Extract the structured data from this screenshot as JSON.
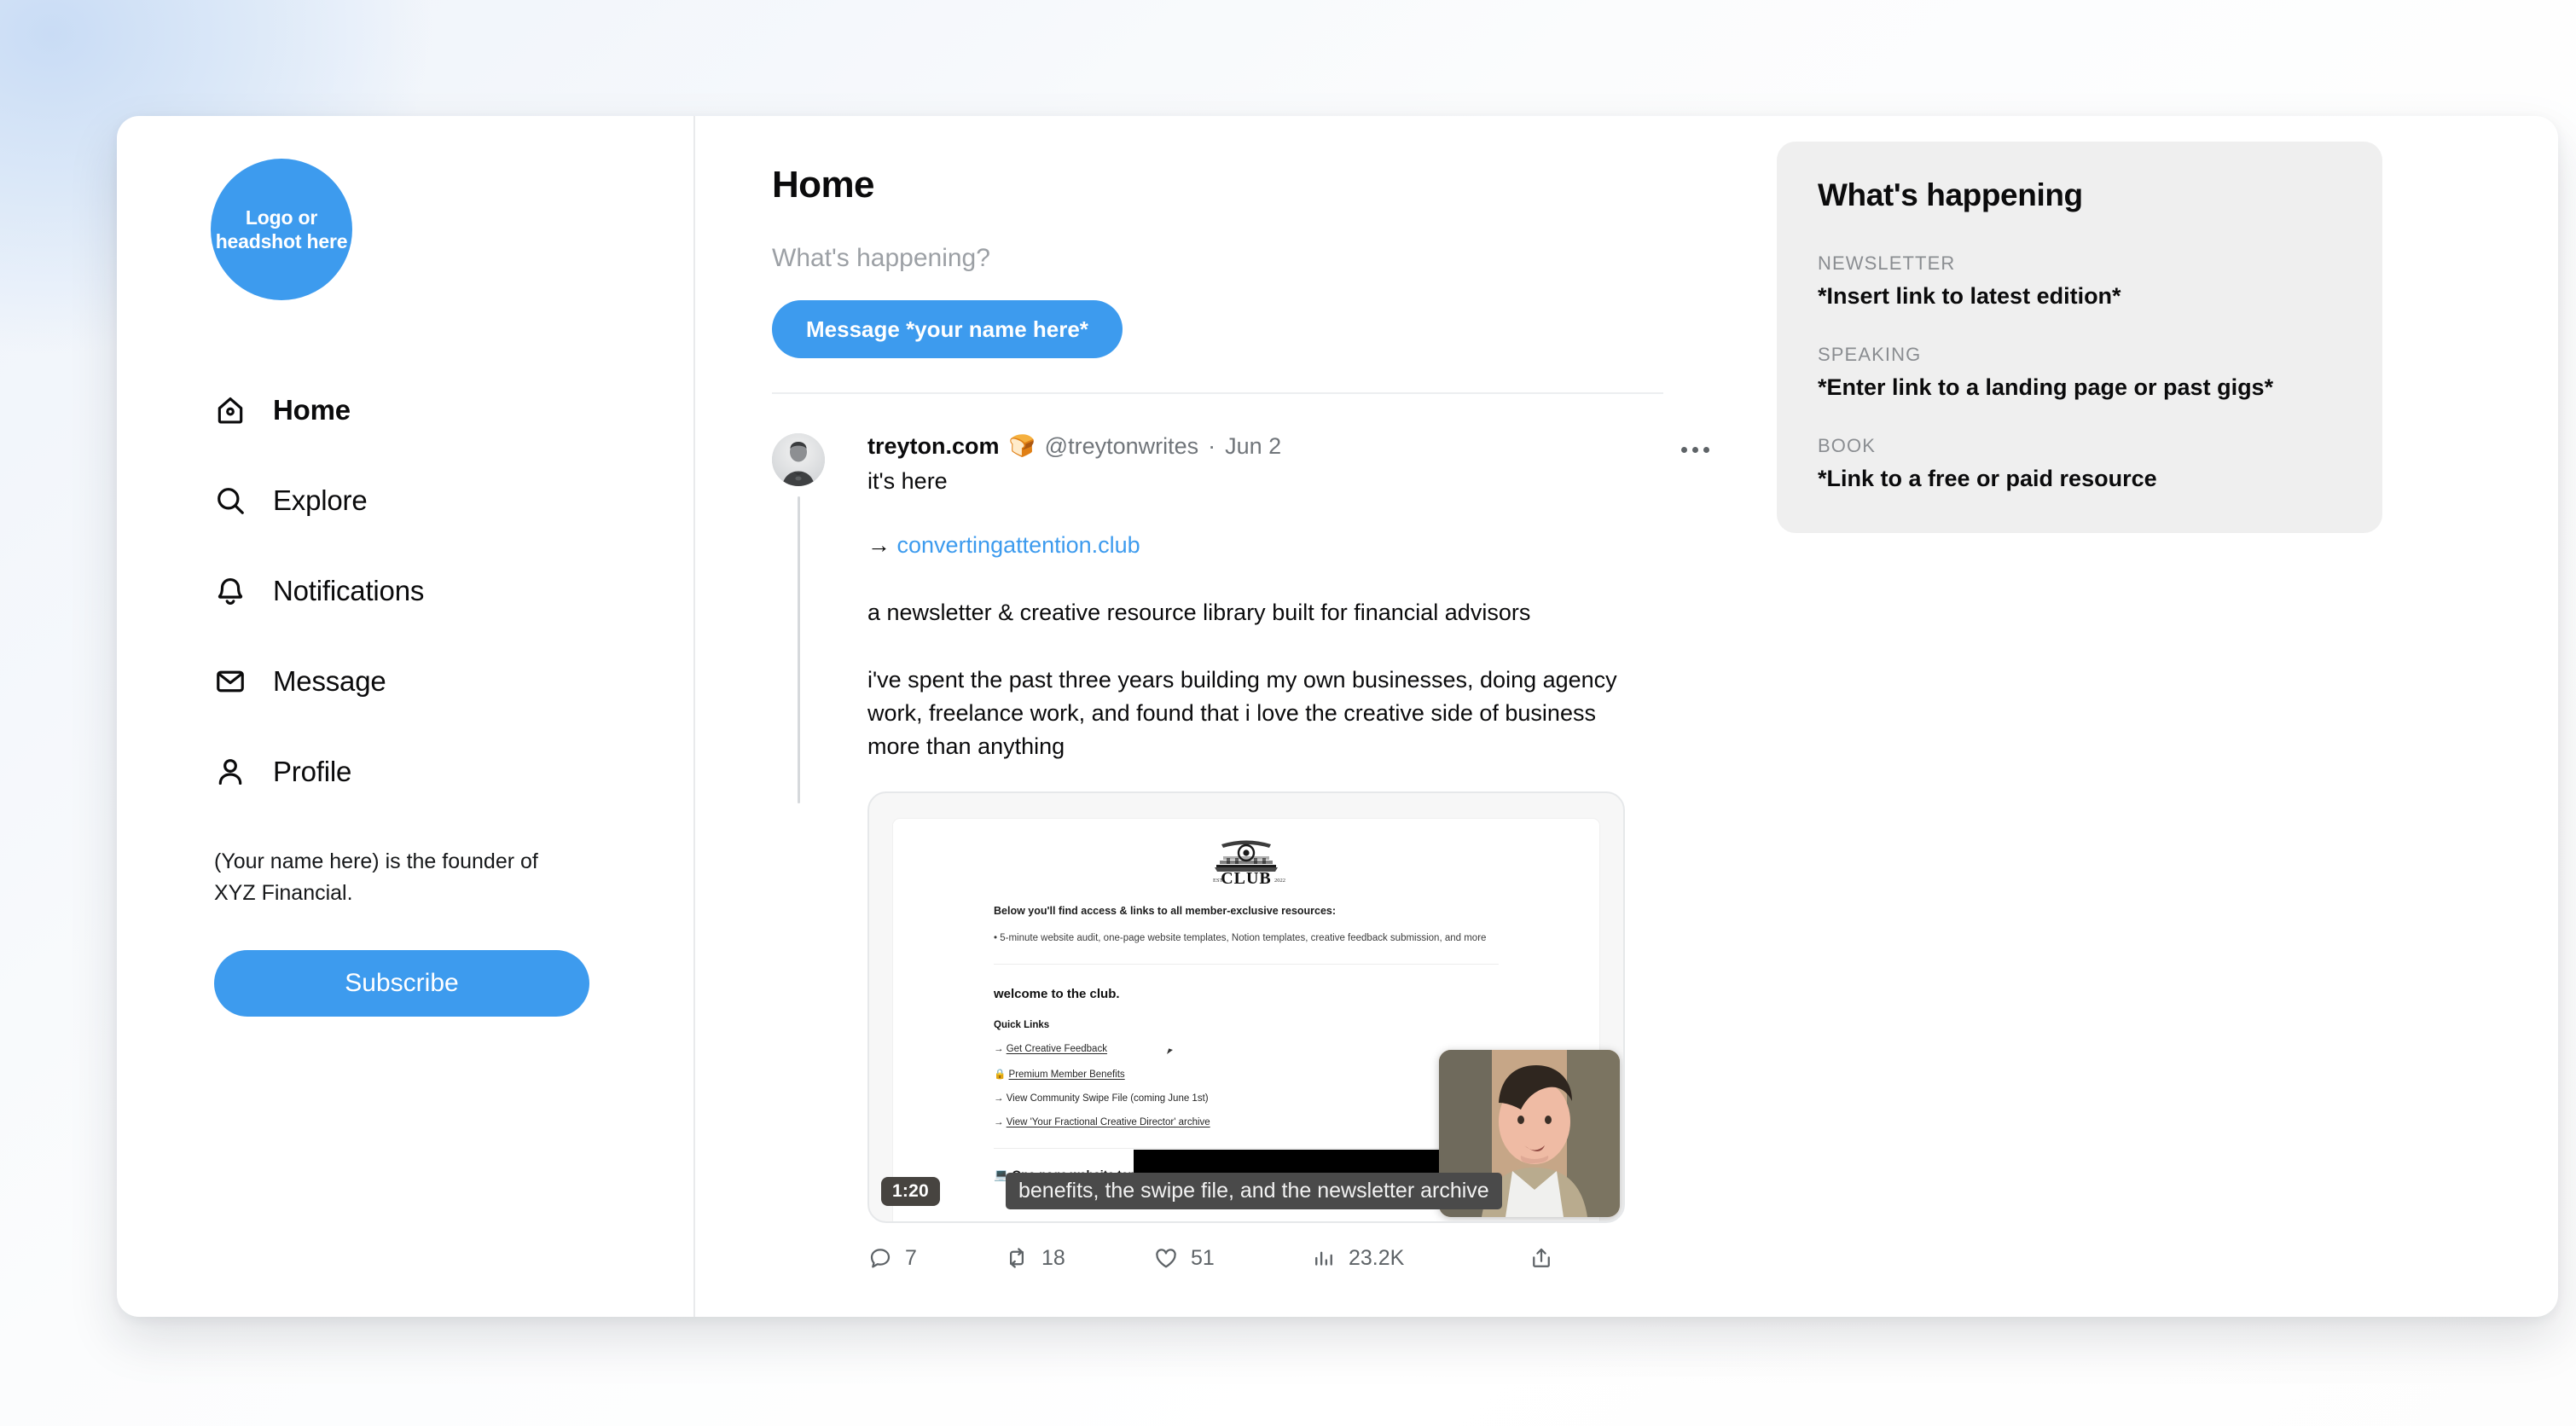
{
  "brand": {
    "accent": "#3d9bee",
    "panel_bg": "#efefef",
    "muted": "#70757a"
  },
  "sidebar": {
    "logo_text": "Logo or headshot here",
    "items": [
      {
        "label": "Home",
        "icon": "home-icon"
      },
      {
        "label": "Explore",
        "icon": "search-icon"
      },
      {
        "label": "Notifications",
        "icon": "bell-icon"
      },
      {
        "label": "Message",
        "icon": "envelope-icon"
      },
      {
        "label": "Profile",
        "icon": "person-icon"
      }
    ],
    "bio": "(Your name here) is the founder of XYZ Financial.",
    "subscribe_label": "Subscribe"
  },
  "main": {
    "page_title": "Home",
    "composer_placeholder": "What's happening?",
    "message_button_label": "Message *your name here*"
  },
  "tweet": {
    "display_name": "treyton.com",
    "badge_emoji": "🍞",
    "handle": "@treytonwrites",
    "separator": "·",
    "date": "Jun 2",
    "line1": "it's here",
    "link_arrow": "→",
    "link_text": "convertingattention.club",
    "para1": "a newsletter & creative resource library built for financial advisors",
    "para2": "i've spent the past three years building my own businesses, doing agency work, freelance work, and found that i love the creative side of business more than anything",
    "more_label": "More",
    "video": {
      "duration": "1:20",
      "caption": "benefits, the swipe file, and the newsletter archive",
      "page": {
        "logo_word": "CLUB",
        "logo_est": "EST",
        "logo_year": "2022",
        "heading": "Below you'll find access & links to all member-exclusive resources:",
        "bullet": "• 5-minute website audit, one-page website templates, Notion templates, creative feedback submission, and more",
        "welcome": "welcome to the club.",
        "quick_links_title": "Quick Links",
        "links": [
          {
            "prefix": "→",
            "text": "Get Creative Feedback",
            "underline": true
          },
          {
            "prefix": "🔒",
            "text": "Premium Member Benefits",
            "underline": true
          },
          {
            "prefix": "→",
            "text": "View Community Swipe File (coming June 1st)",
            "underline": false
          },
          {
            "prefix": "→",
            "text": "View 'Your Fractional Creative Director' archive",
            "underline": true
          }
        ],
        "section": "💻 One-page website templates"
      }
    },
    "actions": [
      {
        "name": "reply",
        "icon": "comment-icon",
        "count": "7"
      },
      {
        "name": "repost",
        "icon": "retweet-icon",
        "count": "18"
      },
      {
        "name": "like",
        "icon": "heart-icon",
        "count": "51"
      },
      {
        "name": "views",
        "icon": "analytics-icon",
        "count": "23.2K"
      },
      {
        "name": "share",
        "icon": "share-icon",
        "count": ""
      }
    ]
  },
  "whats_happening": {
    "title": "What's happening",
    "items": [
      {
        "kicker": "NEWSLETTER",
        "value": "*Insert link to latest edition*"
      },
      {
        "kicker": "SPEAKING",
        "value": "*Enter link to a landing page or past gigs*"
      },
      {
        "kicker": "BOOK",
        "value": "*Link to a free or paid resource"
      }
    ]
  }
}
